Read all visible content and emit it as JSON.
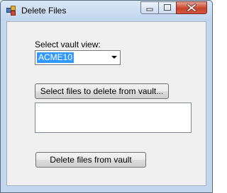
{
  "window": {
    "title": "Delete Files",
    "icon": "app-icon",
    "controls": [
      "minimize-icon",
      "maximize-icon",
      "close-icon"
    ]
  },
  "form": {
    "vault_view_label": "Select vault view:",
    "vault_view": {
      "selected": "ACME10"
    },
    "select_files_button": "Select files to delete from vault...",
    "files_list": [],
    "delete_button": "Delete files from vault"
  },
  "colors": {
    "selection": "#3399ff",
    "titlebar": "#c2d7ee",
    "close_button": "#c7432b"
  }
}
